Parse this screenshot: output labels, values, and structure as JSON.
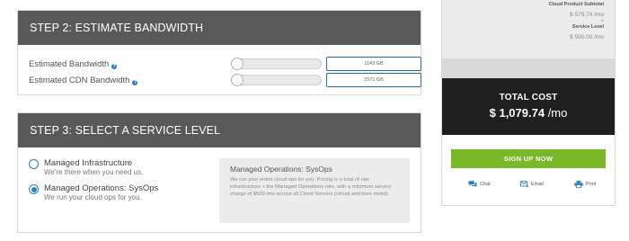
{
  "step2": {
    "title": "STEP 2: ESTIMATE BANDWIDTH",
    "rows": [
      {
        "label": "Estimated Bandwidth",
        "value": "1143 GB",
        "slider_fraction": 0
      },
      {
        "label": "Estimated CDN Bandwidth",
        "value": "2571 GB",
        "slider_fraction": 0
      }
    ]
  },
  "step3": {
    "title": "STEP 3: SELECT A SERVICE LEVEL",
    "levels": [
      {
        "title": "Managed Infrastructure",
        "desc": "We're there when you need us.",
        "selected": false
      },
      {
        "title": "Managed Operations: SysOps",
        "desc": "We run your cloud ops for you.",
        "selected": true
      }
    ],
    "info_box": {
      "title": "Managed Operations: SysOps",
      "text": "We run your entire cloud ops for you. Pricing is a total of raw infrastructure + the Managed Operations rate, with a minimum service charge of $500 /mo across all Cloud Servers (virtual and bare metal)."
    }
  },
  "summary": {
    "subtotal_label": "Cloud Product Subtotal",
    "subtotal_value": "$ 579.74 /mo",
    "plus": "+",
    "service_label": "Service Level",
    "service_value": "$ 500.00 /mo"
  },
  "total": {
    "label": "TOTAL COST",
    "amount": "$ 1,079.74",
    "period": " /mo"
  },
  "actions": {
    "signup": "SIGN UP NOW",
    "chat": "Chat",
    "email": "Email",
    "print": "Print"
  },
  "colors": {
    "header_bg": "#595959",
    "accent_blue": "#2b80c5",
    "signup_green": "#78b829",
    "total_bg": "#1f1f1f"
  }
}
